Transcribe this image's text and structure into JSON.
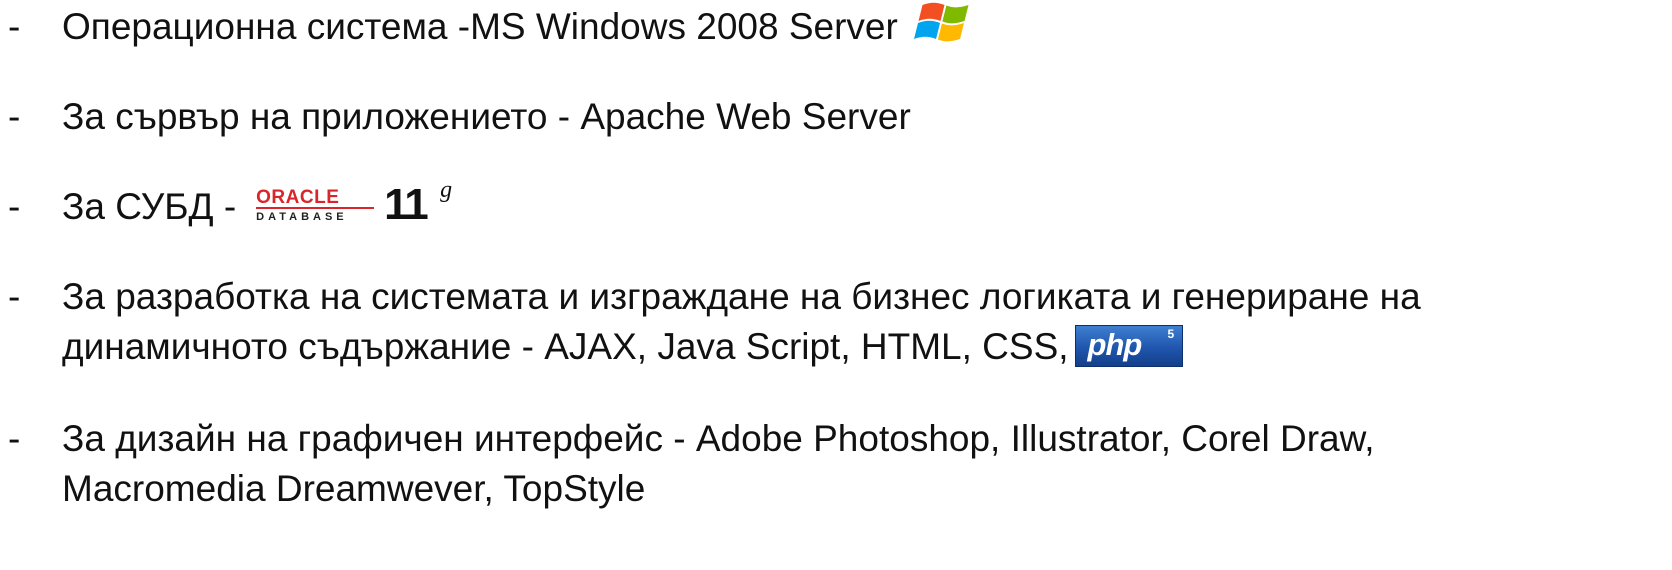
{
  "bullet_marker": "-",
  "items": [
    {
      "lines": [
        "Операционна система -MS Windows 2008 Server"
      ],
      "logo": "windows-flag-icon"
    },
    {
      "lines": [
        "За сървър на приложението - Apache Web Server"
      ]
    },
    {
      "lines": [
        "За СУБД  -"
      ],
      "logo": "oracle-database-logo",
      "logo_text": {
        "brand": "ORACLE",
        "product": "DATABASE",
        "version": "11",
        "version_suffix": "g"
      }
    },
    {
      "lines": [
        "За разработка на системата и изграждане на бизнес логиката и генериране на",
        "динамичното съдържание - AJAX, Java Script, HTML, CSS,"
      ],
      "logo": "php-logo",
      "logo_text": {
        "name": "php",
        "version": "5"
      }
    },
    {
      "lines": [
        "За дизайн на графичен интерфейс - Adobe Photoshop, Illustrator, Corel Draw,",
        "Macromedia Dreamwever, TopStyle"
      ]
    }
  ],
  "colors": {
    "text": "#111111",
    "oracle_red": "#d8262a",
    "php_blue": "#1f56ad",
    "windows_red": "#f25022",
    "windows_green": "#7fba00",
    "windows_blue": "#00a4ef",
    "windows_yellow": "#ffb900"
  }
}
